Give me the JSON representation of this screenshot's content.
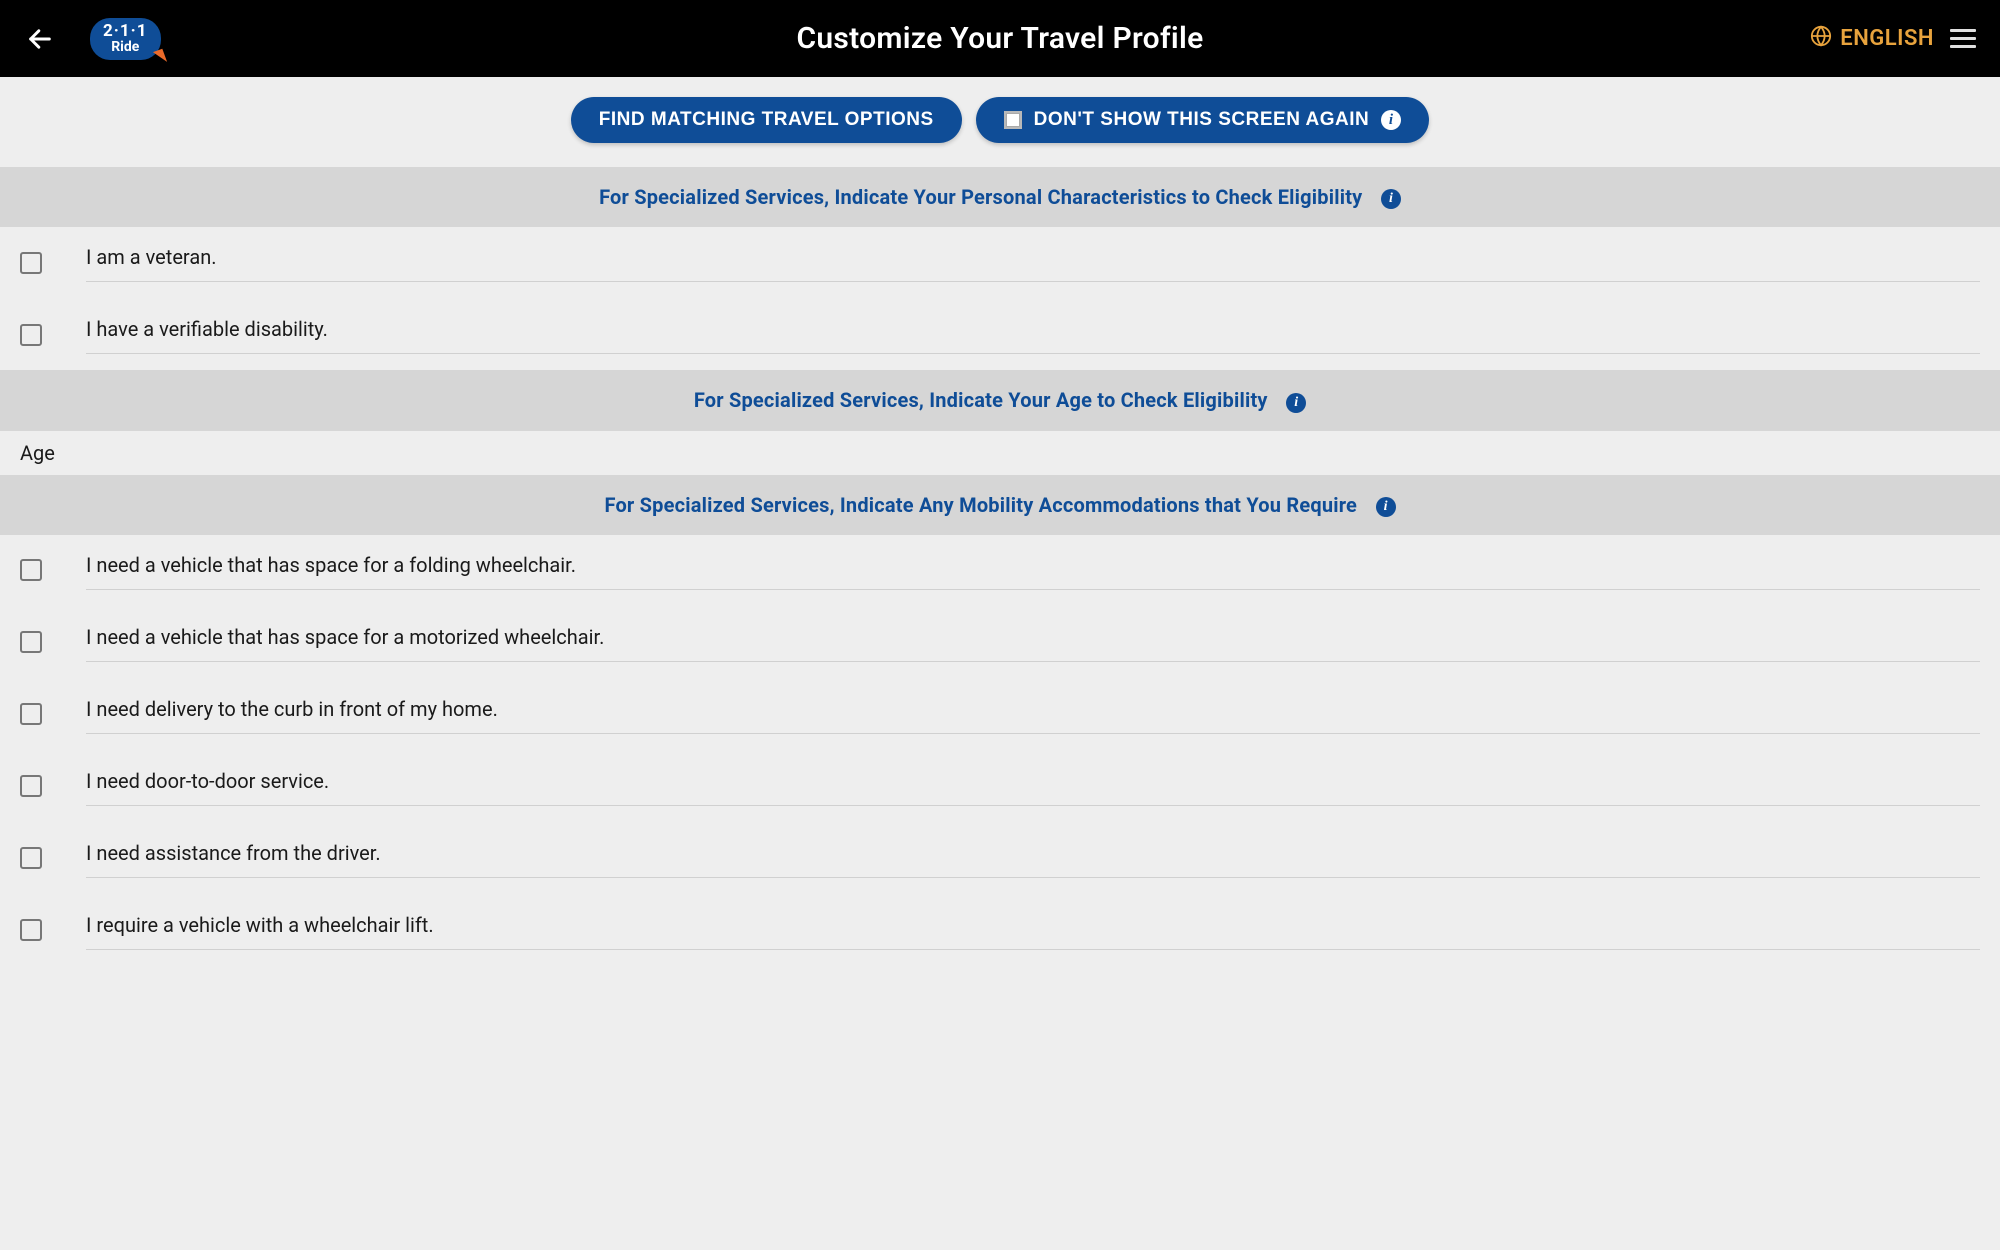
{
  "header": {
    "title": "Customize Your Travel Profile",
    "logo_line1": "2·1·1",
    "logo_line2": "Ride",
    "language_label": "ENGLISH"
  },
  "actions": {
    "find_label": "FIND MATCHING TRAVEL OPTIONS",
    "dont_show_label": "DON'T SHOW THIS SCREEN AGAIN"
  },
  "sections": {
    "personal": {
      "heading": "For Specialized Services, Indicate Your Personal Characteristics to Check Eligibility",
      "items": [
        "I am a veteran.",
        "I have a verifiable disability."
      ]
    },
    "age": {
      "heading": "For Specialized Services, Indicate Your Age to Check Eligibility",
      "field_label": "Age"
    },
    "mobility": {
      "heading": "For Specialized Services, Indicate Any Mobility Accommodations that You Require",
      "items": [
        "I need a vehicle that has space for a folding wheelchair.",
        "I need a vehicle that has space for a motorized wheelchair.",
        "I need delivery to the curb in front of my home.",
        "I need door-to-door service.",
        "I need assistance from the driver.",
        "I require a vehicle with a wheelchair lift."
      ]
    }
  }
}
